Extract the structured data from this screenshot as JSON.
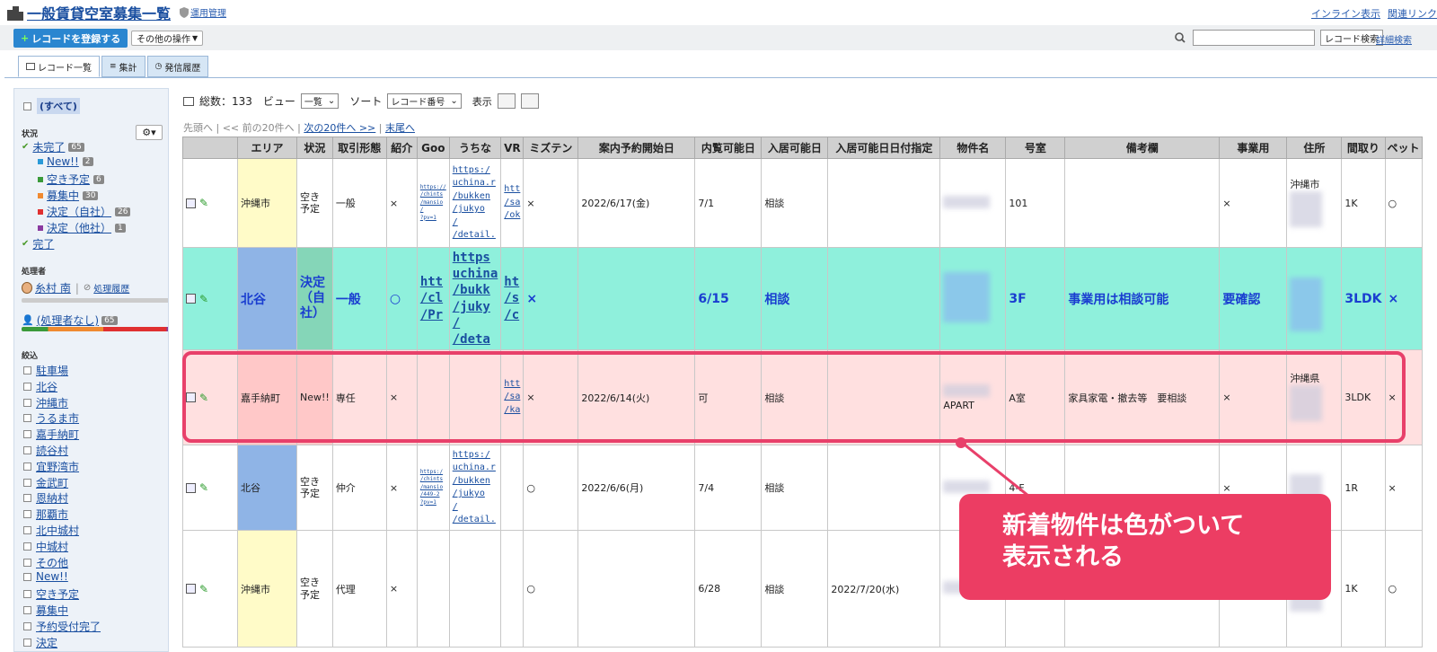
{
  "header": {
    "title": "一般賃貸空室募集一覧",
    "ops_link": "運用管理",
    "inline_view": "インライン表示",
    "related_links": "関連リンク"
  },
  "toolbar": {
    "add_record": "レコードを登録する",
    "other_ops": "その他の操作",
    "search_btn": "レコード検索",
    "advanced_search": "詳細検索",
    "search_placeholder": ""
  },
  "tabs": [
    {
      "label": "レコード一覧"
    },
    {
      "label": "集計"
    },
    {
      "label": "発信履歴"
    }
  ],
  "sidebar": {
    "all": "(すべて)",
    "status_heading": "状況",
    "statuses": [
      {
        "label": "未完了",
        "count": "65"
      },
      {
        "label": "New!!",
        "count": "2",
        "color": "#2a9ad8"
      },
      {
        "label": "空き予定",
        "count": "6",
        "color": "#3a9a3a"
      },
      {
        "label": "募集中",
        "count": "30",
        "color": "#f08a30"
      },
      {
        "label": "決定（自社）",
        "count": "26",
        "color": "#e03030"
      },
      {
        "label": "決定（他社）",
        "count": "1",
        "color": "#8a3aa0"
      },
      {
        "label": "完了",
        "count": ""
      }
    ],
    "handler_heading": "処理者",
    "handler_name": "糸村 南",
    "handler_history": "処理履歴",
    "no_handler": "(処理者なし)",
    "no_handler_count": "65",
    "filter_heading": "絞込",
    "filters": [
      "駐車場",
      "北谷",
      "沖縄市",
      "うるま市",
      "嘉手納町",
      "読谷村",
      "宜野湾市",
      "金武町",
      "恩納村",
      "那覇市",
      "北中城村",
      "中城村",
      "その他",
      "New!!",
      "空き予定",
      "募集中",
      "予約受付完了",
      "決定"
    ]
  },
  "listbar": {
    "total_label": "総数：133",
    "view_label": "ビュー",
    "view_value": "一覧",
    "sort_label": "ソート",
    "sort_value": "レコード番号",
    "display_label": "表示"
  },
  "pager": {
    "first": "先頭へ",
    "prev": "<< 前の20件へ",
    "next": "次の20件へ >>",
    "last": "末尾へ",
    "sep": " | "
  },
  "columns": [
    "",
    "エリア",
    "状況",
    "取引形態",
    "紹介",
    "Goo",
    "うちな",
    "VR",
    "ミズテン",
    "案内予約開始日",
    "内覧可能日",
    "入居可能日",
    "入居可能日日付指定",
    "物件名",
    "号室",
    "備考欄",
    "事業用",
    "住所",
    "間取り",
    "ペット"
  ],
  "rows": [
    {
      "area": "沖縄市",
      "status": "空き予定",
      "deal": "一般",
      "intro": "×",
      "goo": "https://\n/chints\n/mansio\n/\n?pv=1",
      "uchina": "https:/\nuchina.r\n/bukken\n/jukyo\n/\n/detail.",
      "vr": "htt\n/sa\n/ok",
      "mizuten": "×",
      "tour_start": "2022/6/17(金)",
      "view_date": "7/1",
      "move_in": "相談",
      "move_in_date": "",
      "property": "",
      "room": "101",
      "notes": "",
      "business": "×",
      "address": "沖縄市",
      "layout": "1K",
      "pet": "○"
    },
    {
      "area": "北谷",
      "status": "決定（自社）",
      "deal": "一般",
      "intro": "○",
      "goo": "htt\n/cl\n/Pr",
      "uchina": "https\nuchina\n/bukk\n/juky\n/\n/deta",
      "vr": "ht\n/s\n/c",
      "mizuten": "×",
      "tour_start": "",
      "view_date": "6/15",
      "move_in": "相談",
      "move_in_date": "",
      "property": "",
      "room": "3F",
      "notes": "事業用は相談可能",
      "business": "要確認",
      "address": "",
      "layout": "3LDK",
      "pet": "×"
    },
    {
      "area": "嘉手納町",
      "status": "New!!",
      "deal": "専任",
      "intro": "×",
      "goo": "",
      "uchina": "",
      "vr": "htt\n/sa\n/ka",
      "mizuten": "×",
      "tour_start": "2022/6/14(火)",
      "view_date": "可",
      "move_in": "相談",
      "move_in_date": "",
      "property": "APART",
      "room": "A室",
      "notes": "家具家電・撤去等　要相談",
      "business": "×",
      "address": "沖縄県",
      "layout": "3LDK",
      "pet": "×"
    },
    {
      "area": "北谷",
      "status": "空き予定",
      "deal": "仲介",
      "intro": "×",
      "goo": "https:/\n/chints\n/mansio\n/449-2\n?pv=1",
      "uchina": "https:/\nuchina.r\n/bukken\n/jukyo\n/\n/detail.",
      "vr": "",
      "mizuten": "○",
      "tour_start": "2022/6/6(月)",
      "view_date": "7/4",
      "move_in": "相談",
      "move_in_date": "",
      "property": "",
      "room": "4-F",
      "notes": "",
      "business": "×",
      "address": "",
      "layout": "1R",
      "pet": "×"
    },
    {
      "area": "沖縄市",
      "status": "空き予定",
      "deal": "代理",
      "intro": "×",
      "goo": "",
      "uchina": "",
      "vr": "",
      "mizuten": "○",
      "tour_start": "",
      "view_date": "6/28",
      "move_in": "相談",
      "move_in_date": "2022/7/20(水)",
      "property": "",
      "room": "",
      "notes": "",
      "business": "",
      "address": "",
      "layout": "1K",
      "pet": "○"
    }
  ],
  "callout": {
    "line1": "新着物件は色がついて",
    "line2": "表示される"
  }
}
